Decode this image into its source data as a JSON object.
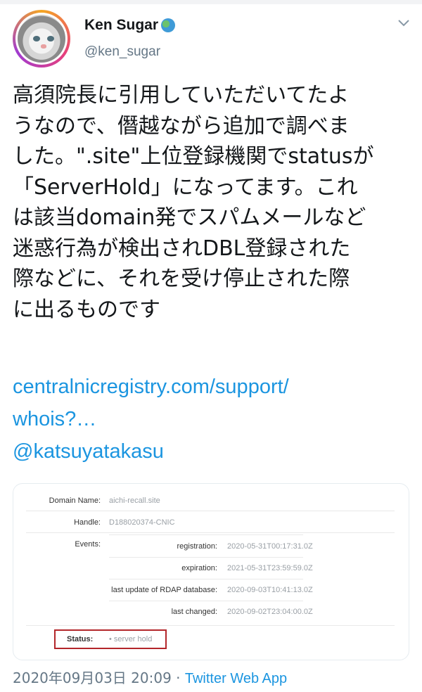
{
  "user": {
    "display_name": "Ken Sugar",
    "badge_icon": "globe-icon",
    "handle": "@ken_sugar"
  },
  "tweet": {
    "lines": [
      "高須院長に引用していただいてたよ",
      "うなので、僭越ながら追加で調べま",
      "した。\".site\"上位登録機関でstatusが",
      "「ServerHold」になってます。これ",
      "は該当domain発でスパムメールなど",
      "迷惑行為が検出されDBL登録された",
      "際などに、それを受け停止された際",
      "に出るものです"
    ],
    "link_lines": [
      "centralnicregistry.com/support/",
      "whois?…"
    ],
    "mention": "@katsuyatakasu"
  },
  "whois": {
    "domain_name_label": "Domain Name:",
    "domain_name_value": "aichi-recall.site",
    "handle_label": "Handle:",
    "handle_value": "D188020374-CNIC",
    "events_label": "Events:",
    "events": [
      {
        "label": "registration:",
        "value": "2020-05-31T00:17:31.0Z"
      },
      {
        "label": "expiration:",
        "value": "2021-05-31T23:59:59.0Z"
      },
      {
        "label": "last update of RDAP database:",
        "value": "2020-09-03T10:41:13.0Z"
      },
      {
        "label": "last changed:",
        "value": "2020-09-02T23:04:00.0Z"
      }
    ],
    "status_label": "Status:",
    "status_value": "•  server hold"
  },
  "footer": {
    "timestamp": "2020年09月03日 20:09",
    "separator": " · ",
    "source": "Twitter Web App"
  },
  "colors": {
    "link": "#1b95e0",
    "meta": "#657786",
    "highlight_border": "#b3262a"
  }
}
